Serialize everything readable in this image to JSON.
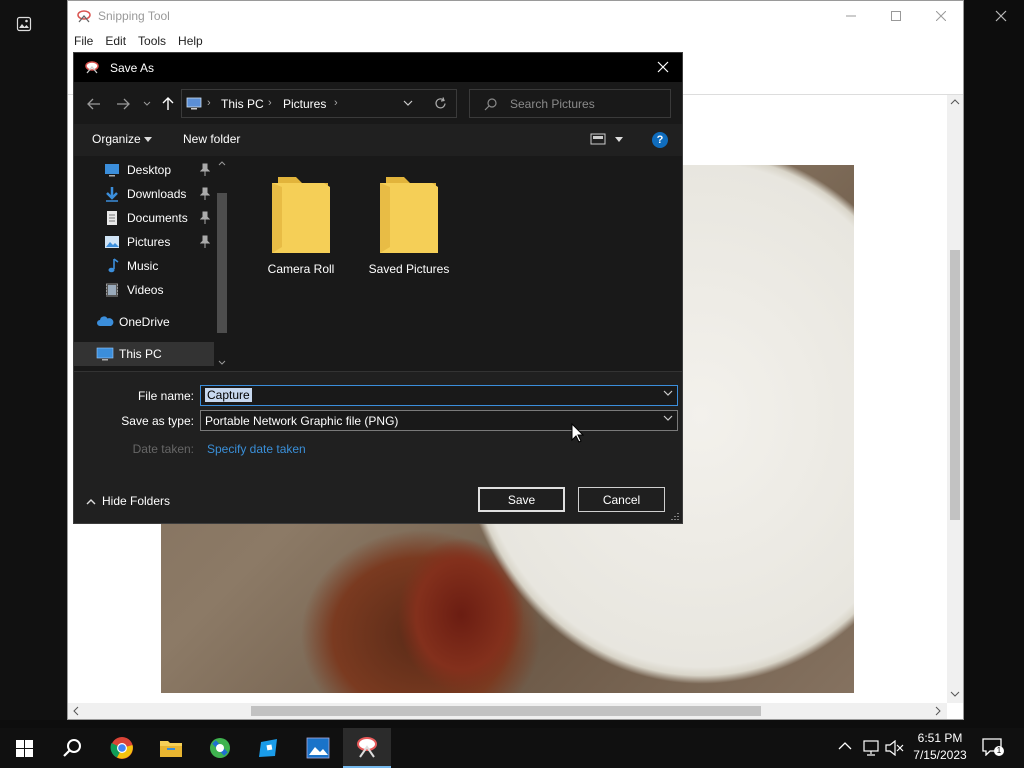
{
  "snipping_tool": {
    "title": "Snipping Tool",
    "menu": [
      "File",
      "Edit",
      "Tools",
      "Help"
    ]
  },
  "dialog": {
    "title": "Save As",
    "address": [
      "This PC",
      "Pictures"
    ],
    "search_placeholder": "Search Pictures",
    "organize_label": "Organize",
    "new_folder_label": "New folder",
    "help_label": "?",
    "nav_items": [
      {
        "label": "Desktop",
        "icon": "desktop-icon",
        "pinned": true
      },
      {
        "label": "Downloads",
        "icon": "downloads-icon",
        "pinned": true
      },
      {
        "label": "Documents",
        "icon": "documents-icon",
        "pinned": true
      },
      {
        "label": "Pictures",
        "icon": "pictures-icon",
        "pinned": true
      },
      {
        "label": "Music",
        "icon": "music-icon",
        "pinned": false
      },
      {
        "label": "Videos",
        "icon": "videos-icon",
        "pinned": false
      },
      {
        "label": "OneDrive",
        "icon": "onedrive-icon",
        "pinned": false
      },
      {
        "label": "This PC",
        "icon": "this-pc-icon",
        "pinned": false
      }
    ],
    "folders": [
      "Camera Roll",
      "Saved Pictures"
    ],
    "file_name_label": "File name:",
    "file_name_value": "Capture",
    "save_type_label": "Save as type:",
    "save_type_value": "Portable Network Graphic file (PNG)",
    "date_taken_label": "Date taken:",
    "date_taken_link": "Specify date taken",
    "hide_folders_label": "Hide Folders",
    "save_label": "Save",
    "cancel_label": "Cancel"
  },
  "taskbar": {
    "apps": [
      "start-icon",
      "search-icon",
      "chrome-icon",
      "file-explorer-icon",
      "paint-3d-icon",
      "roblox-studio-icon",
      "photos-icon",
      "snipping-tool-icon"
    ],
    "time": "6:51 PM",
    "date": "7/15/2023",
    "notification_count": "1"
  },
  "colors": {
    "accent": "#0f6cbd",
    "folder": "#f5cf57",
    "link": "#3a8fd8"
  }
}
